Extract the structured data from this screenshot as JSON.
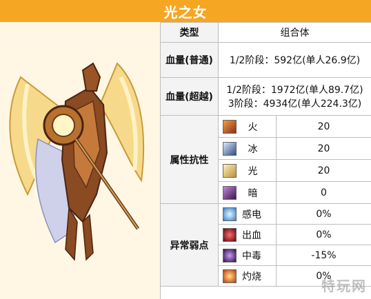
{
  "title": "光之女",
  "rows": {
    "type": {
      "label": "类型",
      "value": "组合体"
    },
    "hp_normal": {
      "label": "血量(普通)",
      "value": "1/2阶段：592亿(单人26.9亿)"
    },
    "hp_super": {
      "label": "血量(超越)",
      "lines": [
        "1/2阶段：1972亿(单人89.7亿)",
        "3阶段：4934亿(单人224.3亿)"
      ]
    },
    "resist": {
      "label": "属性抗性",
      "items": [
        {
          "name": "火",
          "value": "20",
          "icon": "fire-icon",
          "color": "#8b2e1a"
        },
        {
          "name": "冰",
          "value": "20",
          "icon": "ice-icon",
          "color": "#2e4f7a"
        },
        {
          "name": "光",
          "value": "20",
          "icon": "light-icon",
          "color": "#b8903c"
        },
        {
          "name": "暗",
          "value": "0",
          "icon": "dark-icon",
          "color": "#5a2a7a"
        }
      ]
    },
    "abnormal": {
      "label": "异常弱点",
      "items": [
        {
          "name": "感电",
          "value": "0%",
          "icon": "shock-icon",
          "color": "#2f7fc4"
        },
        {
          "name": "出血",
          "value": "0%",
          "icon": "bleed-icon",
          "color": "#b4121a"
        },
        {
          "name": "中毒",
          "value": "-15%",
          "icon": "poison-icon",
          "color": "#5b2a9a"
        },
        {
          "name": "灼烧",
          "value": "0%",
          "icon": "burn-icon",
          "color": "#d4661a"
        }
      ]
    }
  },
  "watermark": "特玩网"
}
